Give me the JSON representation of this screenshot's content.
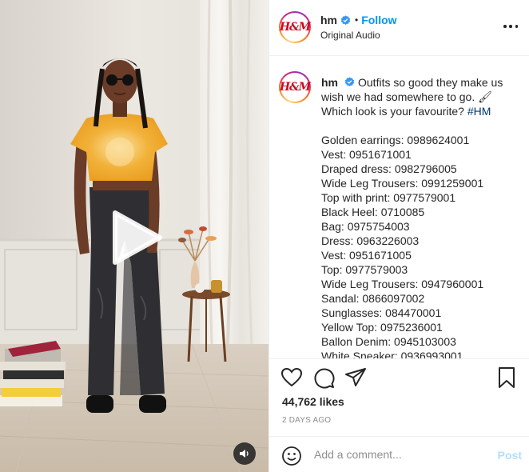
{
  "colors": {
    "follow_blue": "#0095f6",
    "hashtag_blue": "#00376b",
    "muted": "#8e8e8e",
    "post_disabled": "#b2dffc",
    "brand_red": "#cc071e"
  },
  "header": {
    "avatar_logo": "H&M",
    "username": "hm",
    "verified_icon": "verified-badge-icon",
    "separator": "•",
    "follow_label": "Follow",
    "subtitle": "Original Audio",
    "more_icon": "more-options-icon"
  },
  "media": {
    "play_icon": "play-icon",
    "audio_icon": "speaker-icon"
  },
  "caption": {
    "avatar_logo": "H&M",
    "username": "hm",
    "text": "Outfits so good they make us wish we had somewhere to go. 🖌 Which look is your favourite?",
    "hashtag": "#HM",
    "items": [
      "Golden earrings: 0989624001",
      "Vest: 0951671001",
      "Draped dress: 0982796005",
      "Wide Leg Trousers: 0991259001",
      "Top with print: 0977579001",
      "Black Heel: 0710085",
      "Bag: 0975754003",
      "Dress: 0963226003",
      "Vest: 0951671005",
      "Top: 0977579003",
      "Wide Leg Trousers: 0947960001",
      "Sandal: 0866097002",
      "Sunglasses: 084470001",
      "Yellow Top: 0975236001",
      "Ballon Denim: 0945103003",
      "White Sneaker: 0936993001"
    ]
  },
  "actions": {
    "like_icon": "heart-icon",
    "comment_icon": "comment-icon",
    "share_icon": "share-icon",
    "save_icon": "bookmark-icon",
    "likes": "44,762 likes",
    "time_ago": "2 DAYS AGO"
  },
  "comment_box": {
    "emoji_icon": "emoji-icon",
    "placeholder": "Add a comment...",
    "post_label": "Post"
  }
}
